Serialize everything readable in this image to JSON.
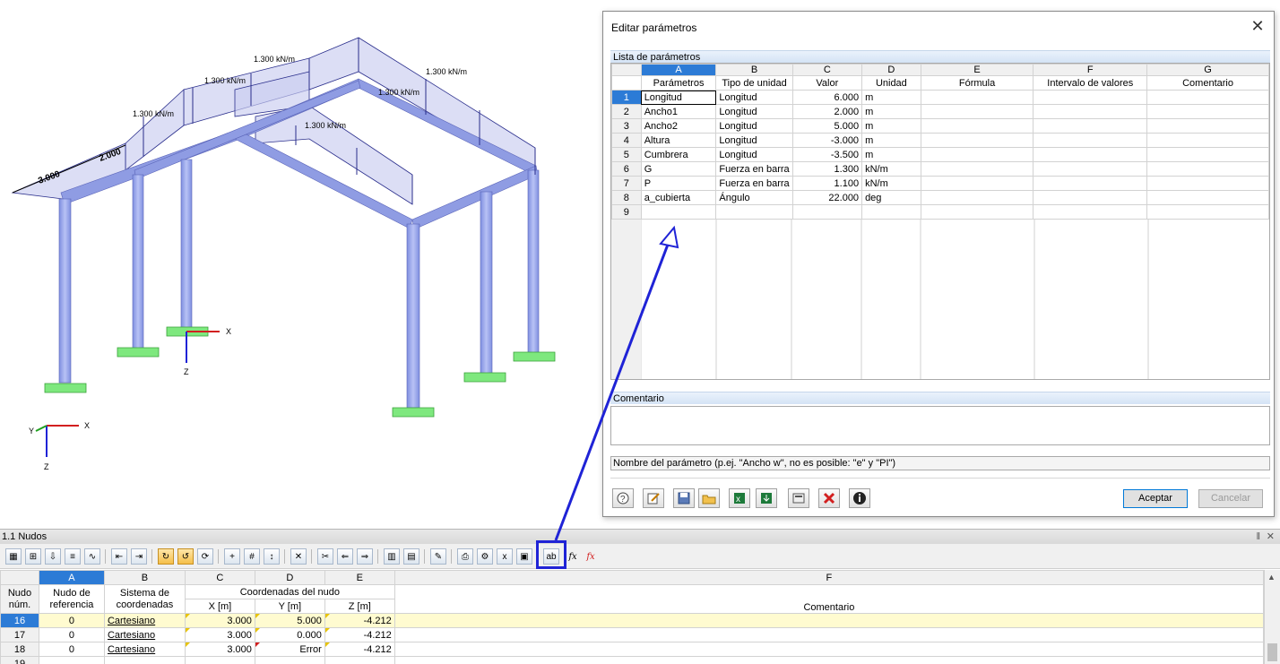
{
  "viewport": {
    "axis_x": "X",
    "axis_y": "Y",
    "axis_z": "Z",
    "loads": [
      "1.300 kN/m",
      "1.300 kN/m",
      "1.300 kN/m",
      "1.300 kN/m",
      "1.300 kN/m",
      "1.300 kN/m"
    ],
    "dims": [
      "3.000",
      "2.000"
    ]
  },
  "dialog": {
    "title": "Editar parámetros",
    "list_header": "Lista de parámetros",
    "columns": [
      "A",
      "B",
      "C",
      "D",
      "E",
      "F",
      "G"
    ],
    "headers": [
      "Parámetros",
      "Tipo de unidad",
      "Valor",
      "Unidad",
      "Fórmula",
      "Intervalo de valores",
      "Comentario"
    ],
    "rows": [
      {
        "n": "1",
        "name": "Longitud",
        "type": "Longitud",
        "value": "6.000",
        "unit": "m"
      },
      {
        "n": "2",
        "name": "Ancho1",
        "type": "Longitud",
        "value": "2.000",
        "unit": "m"
      },
      {
        "n": "3",
        "name": "Ancho2",
        "type": "Longitud",
        "value": "5.000",
        "unit": "m"
      },
      {
        "n": "4",
        "name": "Altura",
        "type": "Longitud",
        "value": "-3.000",
        "unit": "m"
      },
      {
        "n": "5",
        "name": "Cumbrera",
        "type": "Longitud",
        "value": "-3.500",
        "unit": "m"
      },
      {
        "n": "6",
        "name": "G",
        "type": "Fuerza en barra",
        "value": "1.300",
        "unit": "kN/m"
      },
      {
        "n": "7",
        "name": "P",
        "type": "Fuerza en barra",
        "value": "1.100",
        "unit": "kN/m"
      },
      {
        "n": "8",
        "name": "a_cubierta",
        "type": "Ángulo",
        "value": "22.000",
        "unit": "deg"
      },
      {
        "n": "9",
        "name": "",
        "type": "",
        "value": "",
        "unit": ""
      }
    ],
    "comment_header": "Comentario",
    "hint": "Nombre del parámetro (p.ej. \"Ancho w\", no es posible: \"e\" y \"PI\")",
    "ok_label": "Aceptar",
    "cancel_label": "Cancelar",
    "close_glyph": "✕"
  },
  "panel": {
    "title": "1.1 Nudos",
    "pin_glyph": "ᵖ",
    "close_glyph": "✕",
    "columns": [
      "A",
      "B",
      "C",
      "D",
      "E",
      "F"
    ],
    "head1": [
      "Nudo",
      "Nudo de",
      "Sistema de",
      "Coordenadas del nudo",
      "Comentario"
    ],
    "head2": [
      "núm.",
      "referencia",
      "coordenadas",
      "X [m]",
      "Y [m]",
      "Z [m]"
    ],
    "rows": [
      {
        "n": "16",
        "ref": "0",
        "sys": "Cartesiano",
        "x": "3.000",
        "y": "5.000",
        "z": "-4.212",
        "comment": ""
      },
      {
        "n": "17",
        "ref": "0",
        "sys": "Cartesiano",
        "x": "3.000",
        "y": "0.000",
        "z": "-4.212",
        "comment": ""
      },
      {
        "n": "18",
        "ref": "0",
        "sys": "Cartesiano",
        "x": "3.000",
        "y": "Error",
        "z": "-4.212",
        "comment": ""
      },
      {
        "n": "19",
        "ref": "",
        "sys": "",
        "x": "",
        "y": "",
        "z": "",
        "comment": ""
      }
    ]
  },
  "colors": {
    "accent": "#2c7bd6",
    "arrow": "#1f23d6",
    "member": "#9aa7e8",
    "support": "#7ee87e",
    "selected_row": "#fffbd0"
  }
}
